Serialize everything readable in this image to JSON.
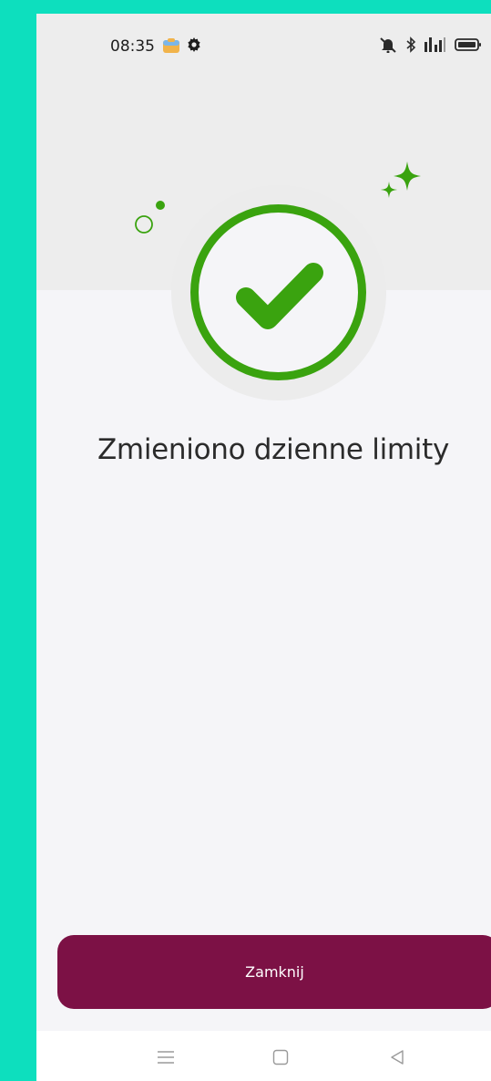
{
  "status_bar": {
    "time": "08:35",
    "icons": [
      "app-notification-icon",
      "gear-icon",
      "mute-icon",
      "bluetooth-icon",
      "signal-icon",
      "battery-icon"
    ]
  },
  "success": {
    "icon": "checkmark-circle-icon",
    "accent_color": "#3aa30f",
    "message": "Zmieniono dzienne limity"
  },
  "actions": {
    "close_label": "Zamknij",
    "close_color": "#7c1145"
  },
  "nav_bar": {
    "buttons": [
      "menu-icon",
      "home-icon",
      "back-icon"
    ]
  }
}
